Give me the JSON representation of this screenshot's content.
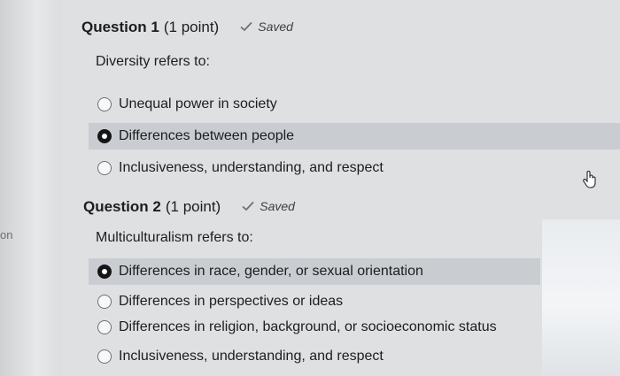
{
  "edge_text": "on",
  "questions": [
    {
      "title": "Question 1",
      "points": "(1 point)",
      "status": "Saved",
      "prompt": "Diversity refers to:",
      "options": [
        {
          "label": "Unequal power in society",
          "selected": false
        },
        {
          "label": "Differences between people",
          "selected": true
        },
        {
          "label": "Inclusiveness, understanding, and respect",
          "selected": false
        }
      ]
    },
    {
      "title": "Question 2",
      "points": "(1 point)",
      "status": "Saved",
      "prompt": "Multiculturalism refers to:",
      "options": [
        {
          "label": "Differences in race, gender, or sexual orientation",
          "selected": true
        },
        {
          "label": "Differences in perspectives or ideas",
          "selected": false
        },
        {
          "label": "Differences in religion, background, or socioeconomic status",
          "selected": false
        },
        {
          "label": "Inclusiveness, understanding, and respect",
          "selected": false
        }
      ]
    }
  ]
}
